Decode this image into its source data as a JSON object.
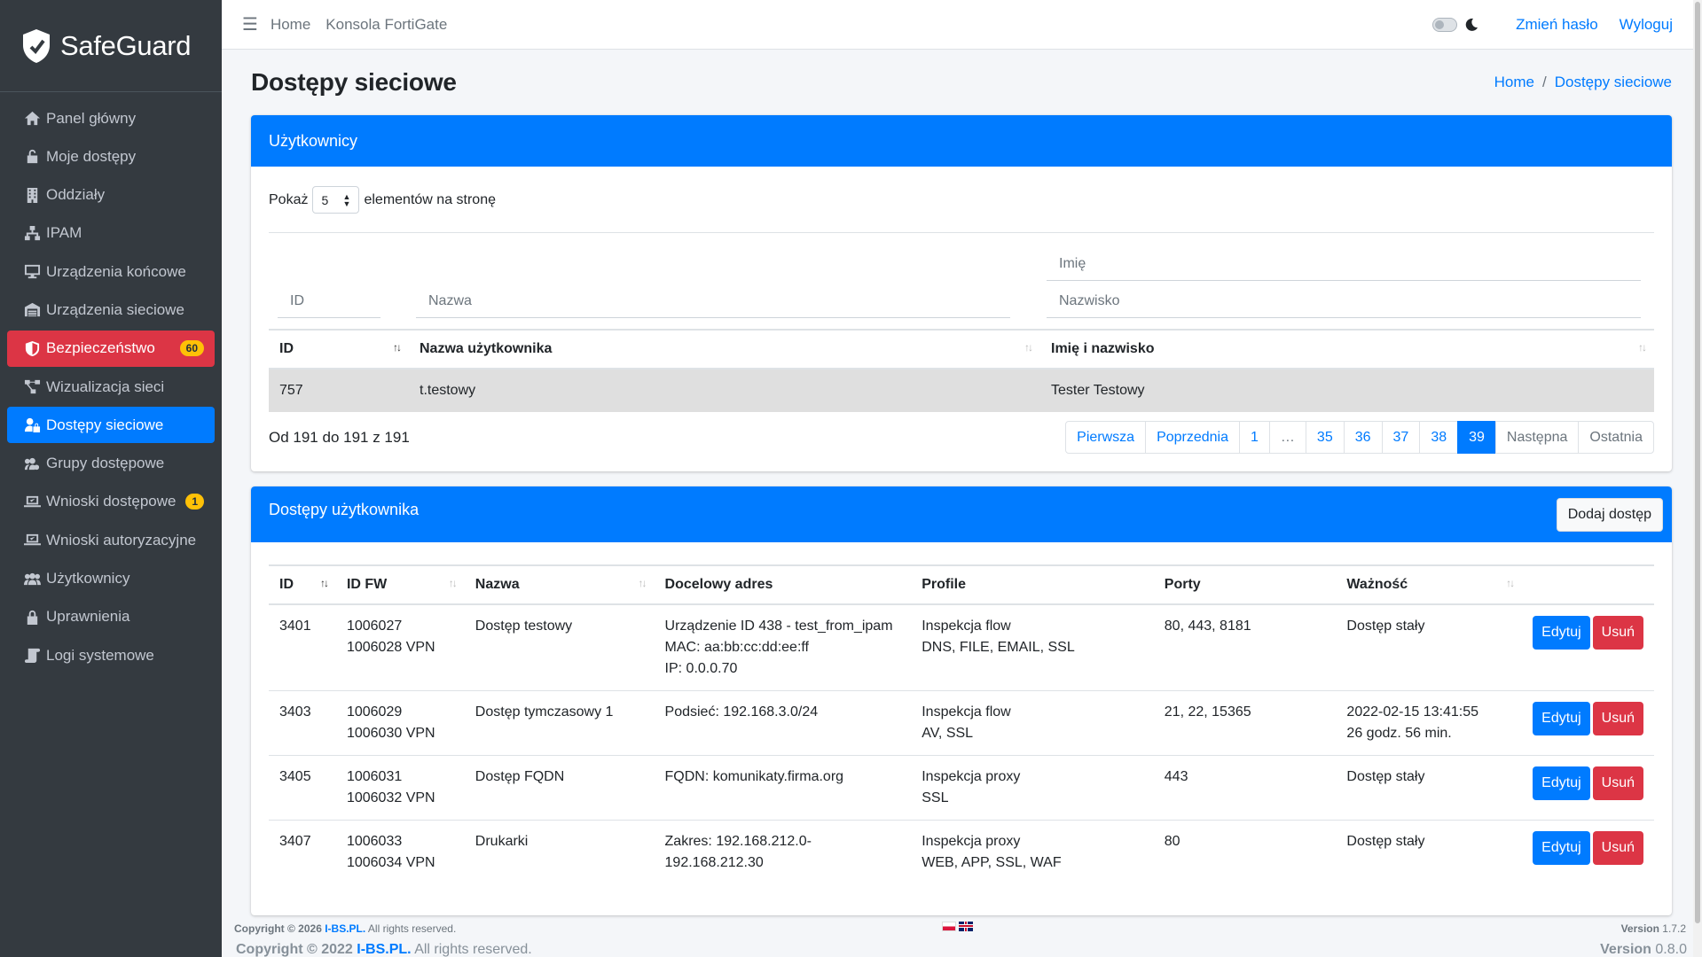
{
  "app": {
    "brand": "SafeGuard"
  },
  "sidebar": {
    "items": [
      {
        "label": "Panel główny",
        "icon": "home-icon"
      },
      {
        "label": "Moje dostępy",
        "icon": "unlock-icon"
      },
      {
        "label": "Oddziały",
        "icon": "building-icon"
      },
      {
        "label": "IPAM",
        "icon": "network-icon"
      },
      {
        "label": "Urządzenia końcowe",
        "icon": "desktop-icon"
      },
      {
        "label": "Urządzenia sieciowe",
        "icon": "warehouse-icon"
      },
      {
        "label": "Bezpieczeństwo",
        "icon": "shield-icon",
        "badge": "60"
      },
      {
        "label": "Wizualizacja sieci",
        "icon": "project-diagram-icon"
      },
      {
        "label": "Dostępy sieciowe",
        "icon": "user-lock-icon"
      },
      {
        "label": "Grupy dostępowe",
        "icon": "users-cog-icon"
      },
      {
        "label": "Wnioski dostępowe",
        "icon": "laptop-check-icon",
        "badge": "1"
      },
      {
        "label": "Wnioski autoryzacyjne",
        "icon": "laptop-check-icon"
      },
      {
        "label": "Użytkownicy",
        "icon": "users-icon"
      },
      {
        "label": "Uprawnienia",
        "icon": "lock-icon"
      },
      {
        "label": "Logi systemowe",
        "icon": "scroll-icon"
      }
    ]
  },
  "topbar": {
    "home": "Home",
    "console": "Konsola FortiGate",
    "change_password": "Zmień hasło",
    "logout": "Wyloguj"
  },
  "page": {
    "title": "Dostępy sieciowe",
    "breadcrumb": [
      "Home",
      "Dostępy sieciowe"
    ]
  },
  "users_card": {
    "title": "Użytkownicy",
    "show_prefix": "Pokaż",
    "show_value": "5",
    "show_suffix": "elementów na stronę",
    "filter_id": "ID",
    "filter_name": "Nazwa",
    "filter_first": "Imię",
    "filter_last": "Nazwisko",
    "columns": [
      "ID",
      "Nazwa użytkownika",
      "Imię i nazwisko"
    ],
    "rows": [
      {
        "id": "757",
        "username": "t.testowy",
        "fullname": "Tester Testowy"
      }
    ],
    "summary": "Od 191 do 191 z 191",
    "pagination": [
      "Pierwsza",
      "Poprzednia",
      "1",
      "…",
      "35",
      "36",
      "37",
      "38",
      "39",
      "Następna",
      "Ostatnia"
    ],
    "active_page": "39"
  },
  "access_card": {
    "title": "Dostępy użytkownika",
    "add_button": "Dodaj dostęp",
    "columns": [
      "ID",
      "ID FW",
      "Nazwa",
      "Docelowy adres",
      "Profile",
      "Porty",
      "Ważność"
    ],
    "edit_label": "Edytuj",
    "delete_label": "Usuń",
    "rows": [
      {
        "id": "3401",
        "fw1": "1006027",
        "fw2": "1006028 VPN",
        "name": "Dostęp testowy",
        "addr": [
          "Urządzenie ID 438 - test_from_ipam",
          "MAC: aa:bb:cc:dd:ee:ff",
          "IP: 0.0.0.70"
        ],
        "profile": [
          "Inspekcja flow",
          "DNS, FILE, EMAIL, SSL"
        ],
        "ports": "80, 443, 8181",
        "validity": [
          "Dostęp stały"
        ]
      },
      {
        "id": "3403",
        "fw1": "1006029",
        "fw2": "1006030 VPN",
        "name": "Dostęp tymczasowy 1",
        "addr": [
          "Podsieć: 192.168.3.0/24"
        ],
        "profile": [
          "Inspekcja flow",
          "AV, SSL"
        ],
        "ports": "21, 22, 15365",
        "validity": [
          "2022-02-15 13:41:55",
          "26 godz. 56 min."
        ]
      },
      {
        "id": "3405",
        "fw1": "1006031",
        "fw2": "1006032 VPN",
        "name": "Dostęp FQDN",
        "addr": [
          "FQDN: komunikaty.firma.org"
        ],
        "profile": [
          "Inspekcja proxy",
          "SSL"
        ],
        "ports": "443",
        "validity": [
          "Dostęp stały"
        ]
      },
      {
        "id": "3407",
        "fw1": "1006033",
        "fw2": "1006034 VPN",
        "name": "Drukarki",
        "addr": [
          "Zakres: 192.168.212.0-",
          "192.168.212.30"
        ],
        "profile": [
          "Inspekcja proxy",
          "WEB, APP, SSL, WAF"
        ],
        "ports": "80",
        "validity": [
          "Dostęp stały"
        ]
      }
    ]
  },
  "footer": {
    "copyright_prefix": "Copyright © 2026",
    "copyright_link": "I-BS.PL.",
    "copyright_suffix": "All rights reserved.",
    "version": "Version",
    "version_num": "1.7.2",
    "copyright2_prefix": "Copyright © 2022",
    "copyright2_link": "I-BS.PL.",
    "copyright2_suffix": "All rights reserved.",
    "version2": "Version",
    "version2_num": "0.8.0"
  }
}
